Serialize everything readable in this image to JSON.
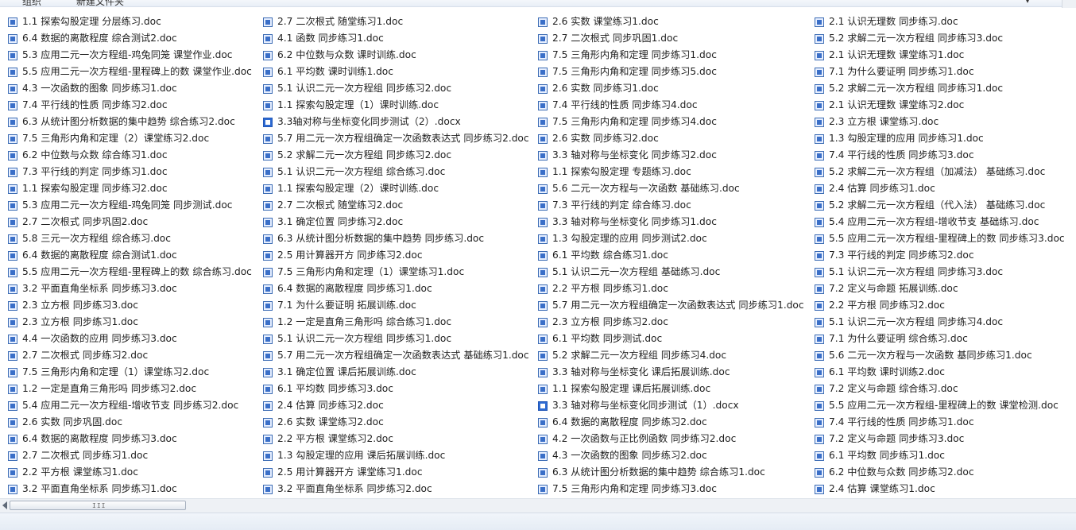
{
  "toolbar": {
    "ghost_left": "组织",
    "ghost_mid": "新建文件夹",
    "ghost_right": "▾"
  },
  "columns": [
    [
      {
        "name": "1.1 探索勾股定理 分层练习.doc",
        "type": "doc"
      },
      {
        "name": "6.4 数据的离散程度 综合测试2.doc",
        "type": "doc"
      },
      {
        "name": "5.3 应用二元一次方程组-鸡兔同笼 课堂作业.doc",
        "type": "doc"
      },
      {
        "name": "5.5 应用二元一次方程组-里程碑上的数 课堂作业.doc",
        "type": "doc"
      },
      {
        "name": "4.3 一次函数的图象 同步练习1.doc",
        "type": "doc"
      },
      {
        "name": "7.4 平行线的性质 同步练习2.doc",
        "type": "doc"
      },
      {
        "name": "6.3 从统计图分析数据的集中趋势 综合练习2.doc",
        "type": "doc"
      },
      {
        "name": "7.5 三角形内角和定理（2）课堂练习2.doc",
        "type": "doc"
      },
      {
        "name": "6.2 中位数与众数 综合练习1.doc",
        "type": "doc"
      },
      {
        "name": "7.3 平行线的判定 同步练习1.doc",
        "type": "doc"
      },
      {
        "name": "1.1 探索勾股定理 同步练习2.doc",
        "type": "doc"
      },
      {
        "name": "5.3 应用二元一次方程组-鸡兔同笼 同步测试.doc",
        "type": "doc"
      },
      {
        "name": "2.7 二次根式 同步巩固2.doc",
        "type": "doc"
      },
      {
        "name": "5.8 三元一次方程组 综合练习.doc",
        "type": "doc"
      },
      {
        "name": "6.4 数据的离散程度 综合测试1.doc",
        "type": "doc"
      },
      {
        "name": "5.5 应用二元一次方程组-里程碑上的数 综合练习.doc",
        "type": "doc"
      },
      {
        "name": "3.2 平面直角坐标系 同步练习3.doc",
        "type": "doc"
      },
      {
        "name": "2.3 立方根 同步练习3.doc",
        "type": "doc"
      },
      {
        "name": "2.3 立方根 同步练习1.doc",
        "type": "doc"
      },
      {
        "name": "4.4 一次函数的应用 同步练习3.doc",
        "type": "doc"
      },
      {
        "name": "2.7 二次根式 同步练习2.doc",
        "type": "doc"
      },
      {
        "name": "7.5 三角形内角和定理（1）课堂练习2.doc",
        "type": "doc"
      },
      {
        "name": "1.2 一定是直角三角形吗 同步练习2.doc",
        "type": "doc"
      },
      {
        "name": "5.4 应用二元一次方程组-增收节支 同步练习2.doc",
        "type": "doc"
      },
      {
        "name": "2.6 实数 同步巩固.doc",
        "type": "doc"
      },
      {
        "name": "6.4 数据的离散程度 同步练习3.doc",
        "type": "doc"
      },
      {
        "name": "2.7 二次根式 同步练习1.doc",
        "type": "doc"
      },
      {
        "name": "2.2 平方根 课堂练习1.doc",
        "type": "doc"
      },
      {
        "name": "3.2 平面直角坐标系 同步练习1.doc",
        "type": "doc"
      }
    ],
    [
      {
        "name": "2.7 二次根式 随堂练习1.doc",
        "type": "doc"
      },
      {
        "name": "4.1 函数 同步练习1.doc",
        "type": "doc"
      },
      {
        "name": "6.2 中位数与众数 课时训练.doc",
        "type": "doc"
      },
      {
        "name": "6.1 平均数 课时训练1.doc",
        "type": "doc"
      },
      {
        "name": "5.1 认识二元一次方程组 同步练习2.doc",
        "type": "doc"
      },
      {
        "name": "1.1 探索勾股定理（1）课时训练.doc",
        "type": "doc"
      },
      {
        "name": "3.3轴对称与坐标变化同步测试（2）.docx",
        "type": "docx"
      },
      {
        "name": "5.7 用二元一次方程组确定一次函数表达式 同步练习2.doc",
        "type": "doc"
      },
      {
        "name": "5.2 求解二元一次方程组 同步练习2.doc",
        "type": "doc"
      },
      {
        "name": "5.1 认识二元一次方程组 综合练习.doc",
        "type": "doc"
      },
      {
        "name": "1.1 探索勾股定理（2）课时训练.doc",
        "type": "doc"
      },
      {
        "name": "2.7 二次根式 随堂练习2.doc",
        "type": "doc"
      },
      {
        "name": "3.1 确定位置 同步练习2.doc",
        "type": "doc"
      },
      {
        "name": "6.3 从统计图分析数据的集中趋势 同步练习.doc",
        "type": "doc"
      },
      {
        "name": "2.5 用计算器开方 同步练习2.doc",
        "type": "doc"
      },
      {
        "name": "7.5 三角形内角和定理（1）课堂练习1.doc",
        "type": "doc"
      },
      {
        "name": "6.4 数据的离散程度 同步练习1.doc",
        "type": "doc"
      },
      {
        "name": "7.1 为什么要证明 拓展训练.doc",
        "type": "doc"
      },
      {
        "name": "1.2 一定是直角三角形吗 综合练习1.doc",
        "type": "doc"
      },
      {
        "name": "5.1 认识二元一次方程组 同步练习1.doc",
        "type": "doc"
      },
      {
        "name": "5.7 用二元一次方程组确定一次函数表达式 基础练习1.doc",
        "type": "doc"
      },
      {
        "name": "3.1 确定位置 课后拓展训练.doc",
        "type": "doc"
      },
      {
        "name": "6.1 平均数 同步练习3.doc",
        "type": "doc"
      },
      {
        "name": "2.4 估算 同步练习2.doc",
        "type": "doc"
      },
      {
        "name": "2.6 实数 课堂练习2.doc",
        "type": "doc"
      },
      {
        "name": "2.2 平方根 课堂练习2.doc",
        "type": "doc"
      },
      {
        "name": "1.3 勾股定理的应用 课后拓展训练.doc",
        "type": "doc"
      },
      {
        "name": "2.5 用计算器开方 课堂练习1.doc",
        "type": "doc"
      },
      {
        "name": "3.2 平面直角坐标系 同步练习2.doc",
        "type": "doc"
      }
    ],
    [
      {
        "name": "2.6 实数 课堂练习1.doc",
        "type": "doc"
      },
      {
        "name": "2.7 二次根式 同步巩固1.doc",
        "type": "doc"
      },
      {
        "name": "7.5 三角形内角和定理 同步练习1.doc",
        "type": "doc"
      },
      {
        "name": "7.5 三角形内角和定理 同步练习5.doc",
        "type": "doc"
      },
      {
        "name": "2.6 实数 同步练习1.doc",
        "type": "doc"
      },
      {
        "name": "7.4 平行线的性质 同步练习4.doc",
        "type": "doc"
      },
      {
        "name": "7.5 三角形内角和定理 同步练习4.doc",
        "type": "doc"
      },
      {
        "name": "2.6 实数 同步练习2.doc",
        "type": "doc"
      },
      {
        "name": "3.3 轴对称与坐标变化 同步练习2.doc",
        "type": "doc"
      },
      {
        "name": "1.1 探索勾股定理 专题练习.doc",
        "type": "doc"
      },
      {
        "name": "5.6 二元一次方程与一次函数 基础练习.doc",
        "type": "doc"
      },
      {
        "name": "7.3 平行线的判定 综合练习.doc",
        "type": "doc"
      },
      {
        "name": "3.3 轴对称与坐标变化 同步练习1.doc",
        "type": "doc"
      },
      {
        "name": "1.3 勾股定理的应用 同步测试2.doc",
        "type": "doc"
      },
      {
        "name": "6.1 平均数 综合练习1.doc",
        "type": "doc"
      },
      {
        "name": "5.1 认识二元一次方程组 基础练习.doc",
        "type": "doc"
      },
      {
        "name": "2.2 平方根 同步练习1.doc",
        "type": "doc"
      },
      {
        "name": "5.7 用二元一次方程组确定一次函数表达式 同步练习1.doc",
        "type": "doc"
      },
      {
        "name": "2.3 立方根 同步练习2.doc",
        "type": "doc"
      },
      {
        "name": "6.1 平均数 同步测试.doc",
        "type": "doc"
      },
      {
        "name": "5.2 求解二元一次方程组 同步练习4.doc",
        "type": "doc"
      },
      {
        "name": "3.3 轴对称与坐标变化 课后拓展训练.doc",
        "type": "doc"
      },
      {
        "name": "1.1 探索勾股定理 课后拓展训练.doc",
        "type": "doc"
      },
      {
        "name": "3.3 轴对称与坐标变化同步测试（1）.docx",
        "type": "docx"
      },
      {
        "name": "6.4 数据的离散程度 同步练习2.doc",
        "type": "doc"
      },
      {
        "name": "4.2 一次函数与正比例函数 同步练习2.doc",
        "type": "doc"
      },
      {
        "name": "4.3 一次函数的图象 同步练习2.doc",
        "type": "doc"
      },
      {
        "name": "6.3 从统计图分析数据的集中趋势 综合练习1.doc",
        "type": "doc"
      },
      {
        "name": "7.5 三角形内角和定理 同步练习3.doc",
        "type": "doc"
      }
    ],
    [
      {
        "name": "2.1 认识无理数 同步练习.doc",
        "type": "doc"
      },
      {
        "name": "5.2 求解二元一次方程组 同步练习3.doc",
        "type": "doc"
      },
      {
        "name": "2.1 认识无理数 课堂练习1.doc",
        "type": "doc"
      },
      {
        "name": "7.1 为什么要证明 同步练习1.doc",
        "type": "doc"
      },
      {
        "name": "5.2 求解二元一次方程组 同步练习1.doc",
        "type": "doc"
      },
      {
        "name": "2.1 认识无理数 课堂练习2.doc",
        "type": "doc"
      },
      {
        "name": "2.3 立方根 课堂练习.doc",
        "type": "doc"
      },
      {
        "name": "1.3 勾股定理的应用 同步练习1.doc",
        "type": "doc"
      },
      {
        "name": "7.4 平行线的性质 同步练习3.doc",
        "type": "doc"
      },
      {
        "name": "5.2 求解二元一次方程组（加减法） 基础练习.doc",
        "type": "doc"
      },
      {
        "name": "2.4 估算 同步练习1.doc",
        "type": "doc"
      },
      {
        "name": "5.2 求解二元一次方程组（代入法） 基础练习.doc",
        "type": "doc"
      },
      {
        "name": "5.4 应用二元一次方程组-增收节支 基础练习.doc",
        "type": "doc"
      },
      {
        "name": "5.5 应用二元一次方程组-里程碑上的数 同步练习3.doc",
        "type": "doc"
      },
      {
        "name": "7.3 平行线的判定 同步练习2.doc",
        "type": "doc"
      },
      {
        "name": "5.1 认识二元一次方程组 同步练习3.doc",
        "type": "doc"
      },
      {
        "name": "7.2 定义与命题 拓展训练.doc",
        "type": "doc"
      },
      {
        "name": "2.2 平方根 同步练习2.doc",
        "type": "doc"
      },
      {
        "name": "5.1 认识二元一次方程组 同步练习4.doc",
        "type": "doc"
      },
      {
        "name": "7.1 为什么要证明 综合练习.doc",
        "type": "doc"
      },
      {
        "name": "5.6 二元一次方程与一次函数 基同步练习1.doc",
        "type": "doc"
      },
      {
        "name": "6.1 平均数 课时训练2.doc",
        "type": "doc"
      },
      {
        "name": "7.2 定义与命题 综合练习.doc",
        "type": "doc"
      },
      {
        "name": "5.5 应用二元一次方程组-里程碑上的数 课堂检测.doc",
        "type": "doc"
      },
      {
        "name": "7.4 平行线的性质 同步练习1.doc",
        "type": "doc"
      },
      {
        "name": "7.2 定义与命题 同步练习3.doc",
        "type": "doc"
      },
      {
        "name": "6.1 平均数 同步练习1.doc",
        "type": "doc"
      },
      {
        "name": "6.2 中位数与众数 同步练习2.doc",
        "type": "doc"
      },
      {
        "name": "2.4 估算 课堂练习1.doc",
        "type": "doc"
      }
    ]
  ],
  "scrollbar": {
    "grip": "III"
  },
  "colors": {
    "doc_icon": "#3a6fc8",
    "docx_icon": "#2d6ad2",
    "text": "#1e1e1e"
  }
}
